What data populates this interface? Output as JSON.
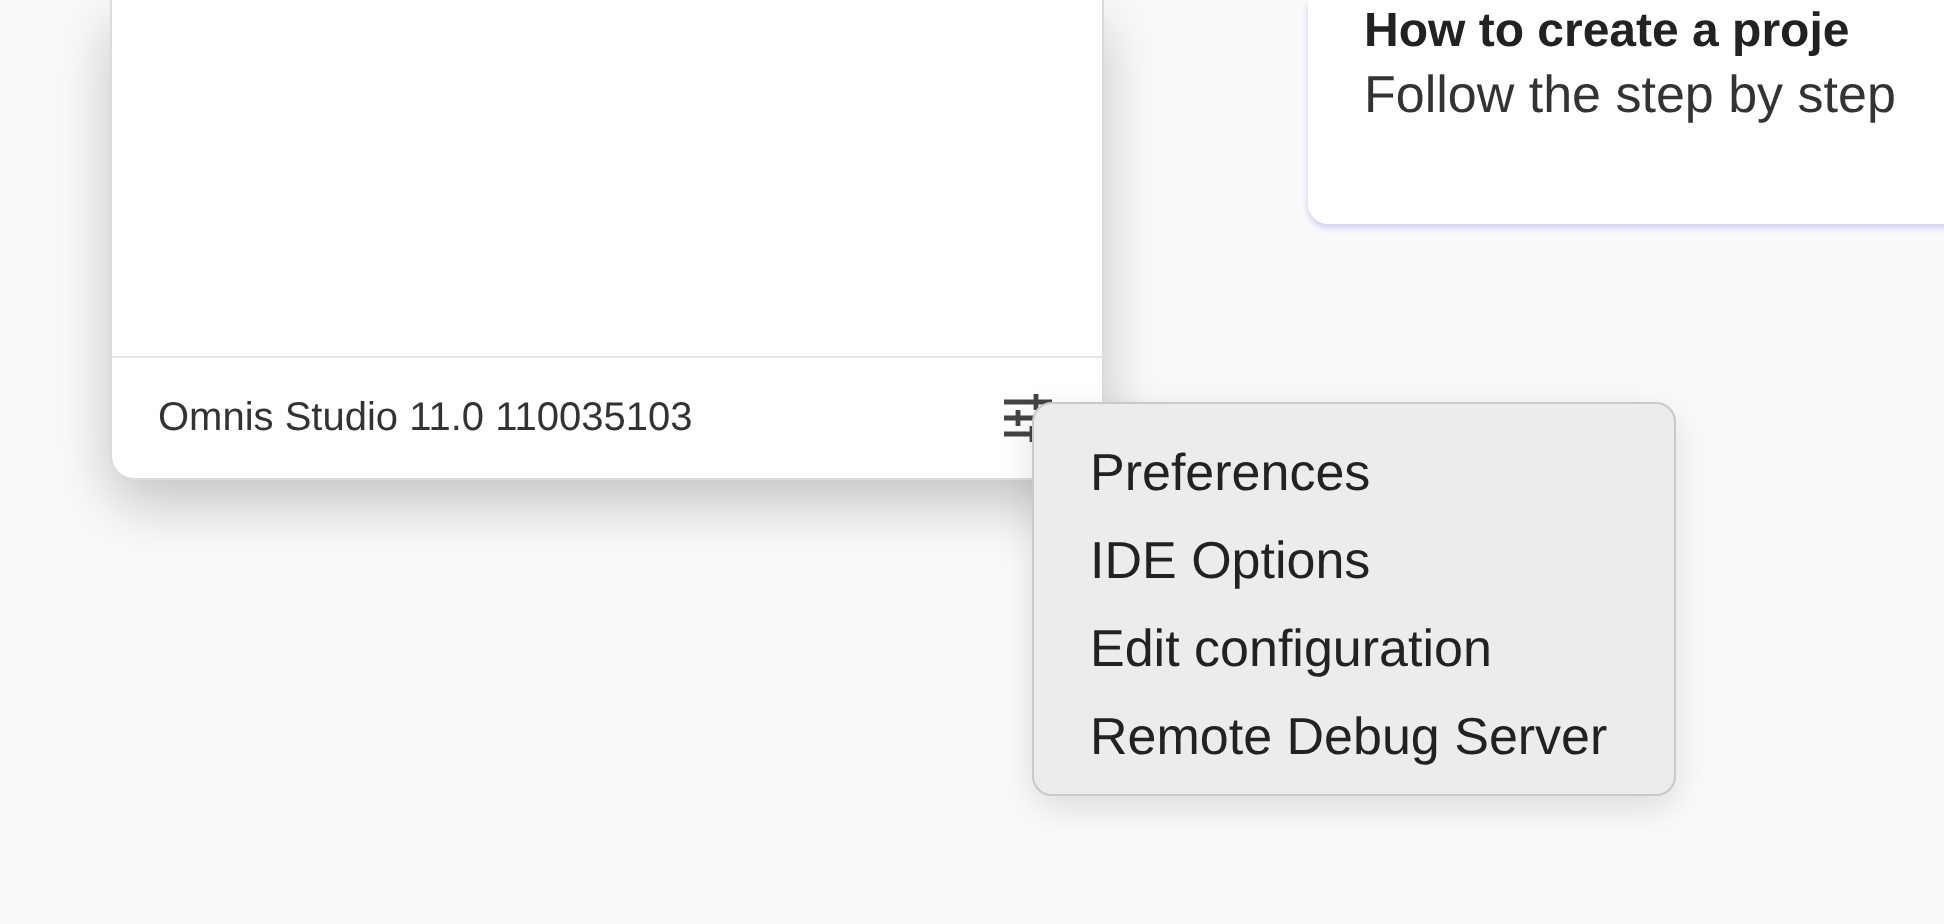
{
  "panel": {
    "version": "Omnis Studio 11.0 110035103"
  },
  "card": {
    "title": "How to create a proje",
    "text": "Follow the step by step"
  },
  "menu": {
    "items": [
      "Preferences",
      "IDE Options",
      "Edit configuration",
      "Remote Debug Server"
    ]
  }
}
